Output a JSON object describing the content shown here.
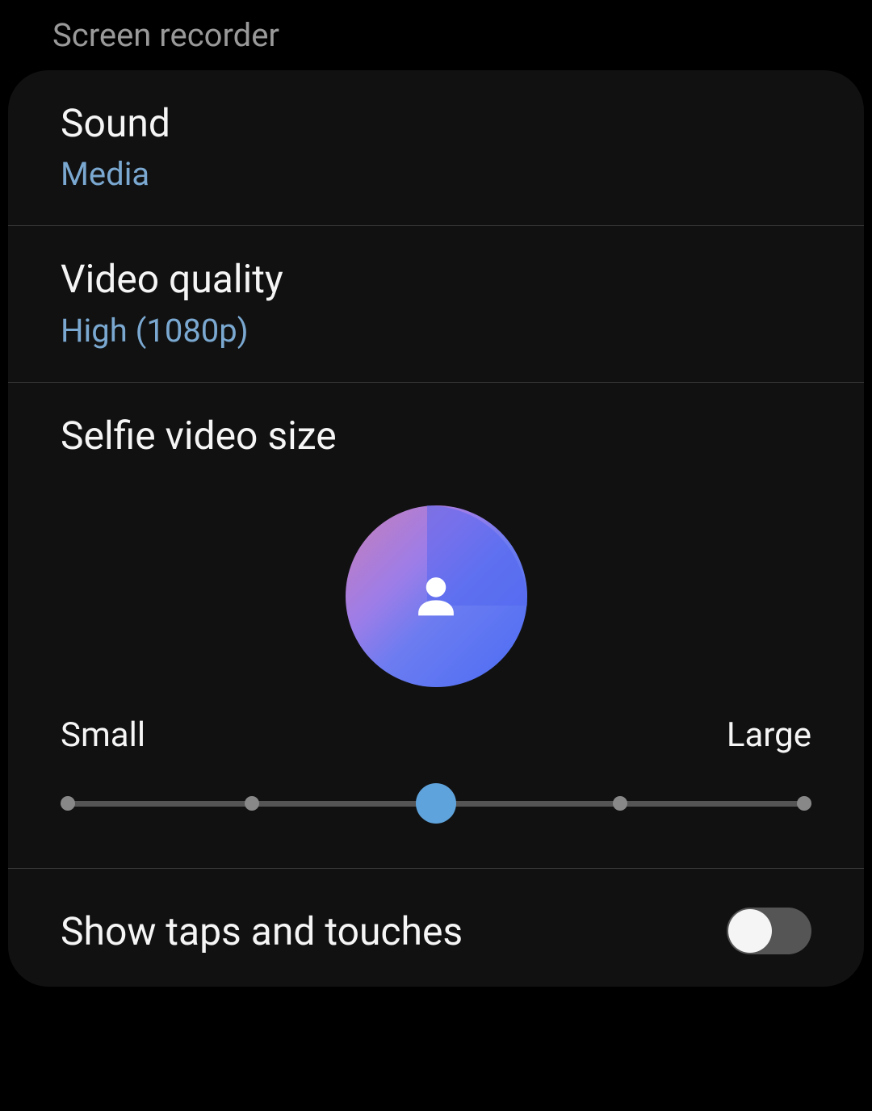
{
  "header": {
    "title": "Screen recorder"
  },
  "settings": {
    "sound": {
      "title": "Sound",
      "value": "Media"
    },
    "videoQuality": {
      "title": "Video quality",
      "value": "High (1080p)"
    },
    "selfieSize": {
      "title": "Selfie video size",
      "labelSmall": "Small",
      "labelLarge": "Large",
      "steps": 5,
      "currentStep": 2
    },
    "showTaps": {
      "title": "Show taps and touches",
      "enabled": false
    }
  }
}
